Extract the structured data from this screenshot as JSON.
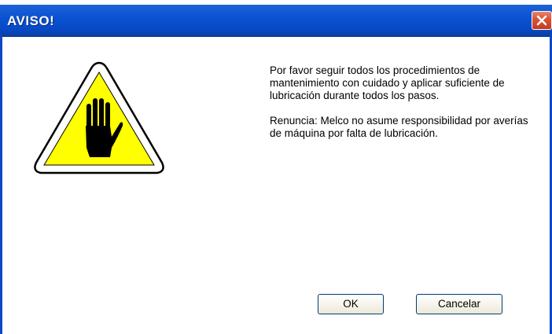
{
  "window": {
    "title": "AVISO!"
  },
  "icons": {
    "close": "close-icon",
    "warning": "stop-hand-warning-icon"
  },
  "message": {
    "paragraph1": "Por favor seguir todos los procedimientos de mantenimiento con cuidado y aplicar suficiente de lubricación durante todos los pasos.",
    "paragraph2": "Renuncia: Melco no asume responsibilidad por averías de máquina por falta de lubricación."
  },
  "buttons": {
    "ok_label": "OK",
    "cancel_label": "Cancelar"
  },
  "colors": {
    "titlebar": "#0a52d2",
    "close_button": "#d9553a",
    "warning_fill": "#ffff00"
  }
}
